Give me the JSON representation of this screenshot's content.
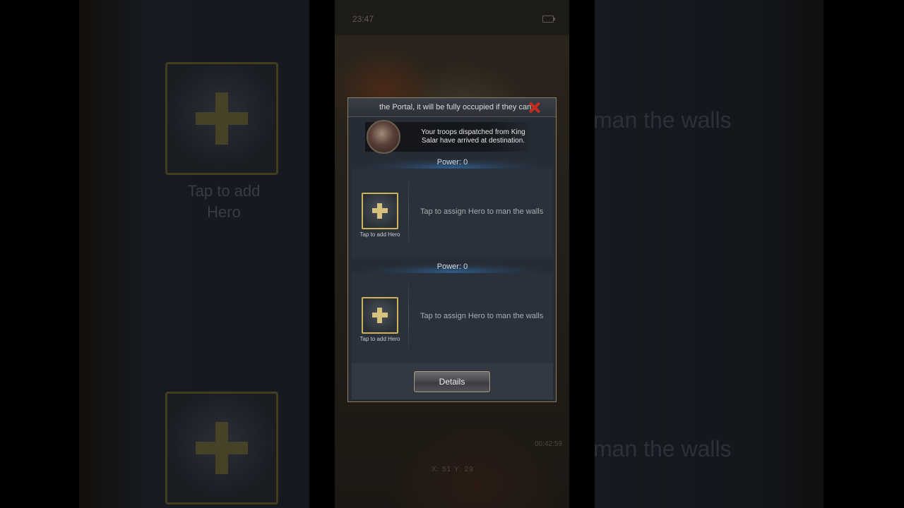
{
  "side_left": {
    "slot_label": "Tap to add\nHero"
  },
  "side_right": {
    "walls_text_1": "man the walls",
    "walls_text_2": "man the walls"
  },
  "status_bar": {
    "time": "23:47"
  },
  "game": {
    "coords": "X: 51  Y: 29",
    "timer": "00:42:59"
  },
  "dialog": {
    "marquee": "the Portal, it will be fully occupied if they can r",
    "notification": "Your troops dispatched from King Salar have arrived at destination.",
    "slots": [
      {
        "power": "Power: 0",
        "hero_label": "Tap to add Hero",
        "assign_text": "Tap to assign Hero to man the walls"
      },
      {
        "power": "Power: 0",
        "hero_label": "Tap to add Hero",
        "assign_text": "Tap to assign Hero to man the walls"
      }
    ],
    "details_label": "Details"
  },
  "icons": [
    "close-icon",
    "plus-icon",
    "battery-icon"
  ],
  "colors": {
    "close_red": "#c82a1e",
    "slot_gold": "#cdb35a",
    "power_blue": "#2e5a88"
  }
}
